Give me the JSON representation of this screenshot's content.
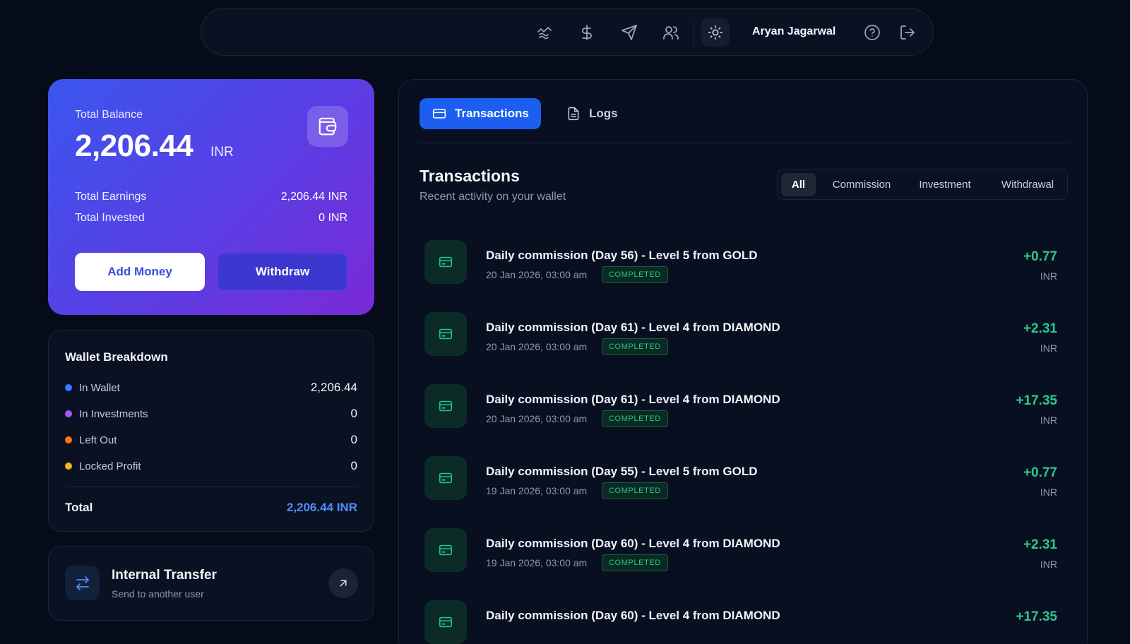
{
  "header": {
    "user_name": "Aryan Jagarwal",
    "icons": [
      "investments-icon",
      "dollar-icon",
      "send-icon",
      "users-icon",
      "sun-icon",
      "help-icon",
      "logout-icon"
    ]
  },
  "balance": {
    "label": "Total Balance",
    "amount": "2,206.44",
    "currency": "INR",
    "earnings_label": "Total Earnings",
    "earnings_value": "2,206.44 INR",
    "invested_label": "Total Invested",
    "invested_value": "0 INR",
    "add_money_label": "Add Money",
    "withdraw_label": "Withdraw"
  },
  "breakdown": {
    "title": "Wallet Breakdown",
    "items": [
      {
        "label": "In Wallet",
        "value": "2,206.44",
        "color": "#3b7bff"
      },
      {
        "label": "In Investments",
        "value": "0",
        "color": "#a855f7"
      },
      {
        "label": "Left Out",
        "value": "0",
        "color": "#f97316"
      },
      {
        "label": "Locked Profit",
        "value": "0",
        "color": "#f5b524"
      }
    ],
    "total_label": "Total",
    "total_value": "2,206.44 INR"
  },
  "transfer": {
    "title": "Internal Transfer",
    "subtitle": "Send to another user"
  },
  "tabs": {
    "transactions": "Transactions",
    "logs": "Logs"
  },
  "transactions": {
    "heading": "Transactions",
    "subheading": "Recent activity on your wallet",
    "filters": [
      "All",
      "Commission",
      "Investment",
      "Withdrawal"
    ],
    "active_filter": "All",
    "items": [
      {
        "title": "Daily commission (Day 56) - Level 5 from GOLD",
        "date": "20 Jan 2026, 03:00 am",
        "status": "COMPLETED",
        "amount": "+0.77",
        "currency": "INR"
      },
      {
        "title": "Daily commission (Day 61) - Level 4 from DIAMOND",
        "date": "20 Jan 2026, 03:00 am",
        "status": "COMPLETED",
        "amount": "+2.31",
        "currency": "INR"
      },
      {
        "title": "Daily commission (Day 61) - Level 4 from DIAMOND",
        "date": "20 Jan 2026, 03:00 am",
        "status": "COMPLETED",
        "amount": "+17.35",
        "currency": "INR"
      },
      {
        "title": "Daily commission (Day 55) - Level 5 from GOLD",
        "date": "19 Jan 2026, 03:00 am",
        "status": "COMPLETED",
        "amount": "+0.77",
        "currency": "INR"
      },
      {
        "title": "Daily commission (Day 60) - Level 4 from DIAMOND",
        "date": "19 Jan 2026, 03:00 am",
        "status": "COMPLETED",
        "amount": "+2.31",
        "currency": "INR"
      },
      {
        "title": "Daily commission (Day 60) - Level 4 from DIAMOND",
        "date": "",
        "status": "",
        "amount": "+17.35",
        "currency": ""
      }
    ]
  }
}
